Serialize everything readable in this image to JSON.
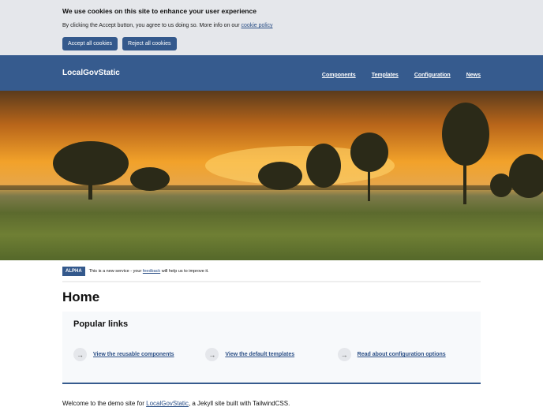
{
  "cookie": {
    "title": "We use cookies on this site to enhance your user experience",
    "text": "By clicking the Accept button, you agree to us doing so. More info on our ",
    "link": "cookie policy",
    "accept": "Accept all cookies",
    "reject": "Reject all cookies"
  },
  "header": {
    "logo": "LocalGovStatic",
    "nav": [
      "Components",
      "Templates",
      "Configuration",
      "News"
    ]
  },
  "banner": {
    "tag": "ALPHA",
    "pre": "This is a new service - your ",
    "link": "feedback",
    "post": " will help us to improve it."
  },
  "page": {
    "title": "Home"
  },
  "popular": {
    "title": "Popular links",
    "links": [
      "View the reusable components",
      "View the default templates",
      "Read about configuration options"
    ],
    "arrow": "→"
  },
  "welcome": {
    "pre": "Welcome to the demo site for ",
    "link": "LocalGovStatic",
    "post": ", a Jekyll site built with TailwindCSS."
  }
}
